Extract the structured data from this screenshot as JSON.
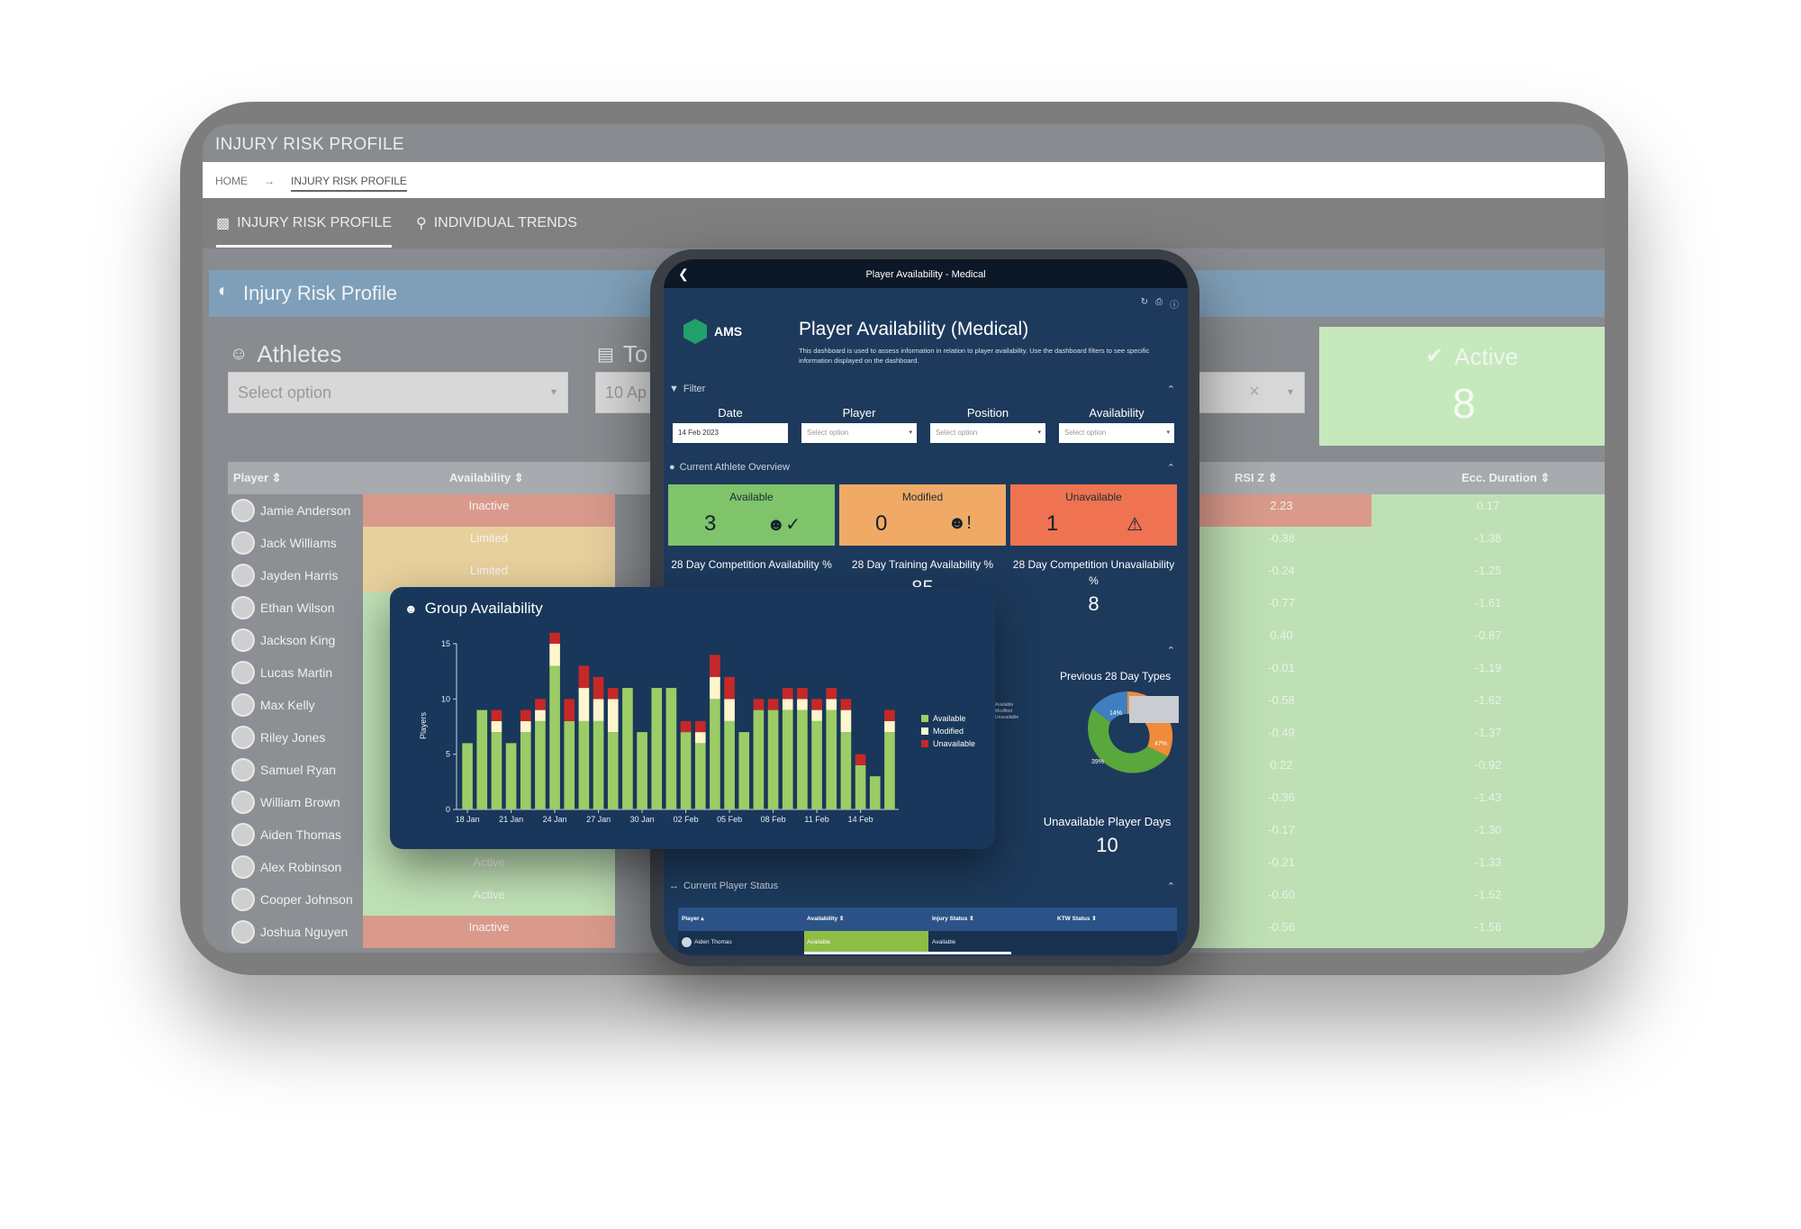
{
  "background_app": {
    "title": "INJURY RISK PROFILE",
    "breadcrumb": [
      "HOME",
      "→",
      "INJURY RISK PROFILE"
    ],
    "tabs": [
      "INJURY RISK PROFILE",
      "INDIVIDUAL TRENDS"
    ],
    "section_title": "Injury Risk Profile",
    "filters": {
      "athletes_label": "Athletes",
      "athletes_placeholder": "Select option",
      "to_label": "To",
      "to_value": "10 Ap"
    },
    "active_card": {
      "label": "Active",
      "value": "8"
    },
    "columns": {
      "player": "Player ⇕",
      "availability": "Availability ⇕",
      "rsi": "RSI Z ⇕",
      "ecc": "Ecc. Duration ⇕"
    },
    "rows": [
      {
        "player": "Jamie Anderson",
        "availability": "Inactive",
        "rsi": "2.23",
        "ecc": "0.17"
      },
      {
        "player": "Jack Williams",
        "availability": "Limited",
        "rsi": "-0.38",
        "ecc": "-1.38"
      },
      {
        "player": "Jayden Harris",
        "availability": "Limited",
        "rsi": "-0.24",
        "ecc": "-1.25"
      },
      {
        "player": "Ethan Wilson",
        "availability": "",
        "rsi": "-0.77",
        "ecc": "-1.61"
      },
      {
        "player": "Jackson King",
        "availability": "",
        "rsi": "0.40",
        "ecc": "-0.87"
      },
      {
        "player": "Lucas Martin",
        "availability": "",
        "rsi": "-0.01",
        "ecc": "-1.19"
      },
      {
        "player": "Max Kelly",
        "availability": "",
        "rsi": "-0.58",
        "ecc": "-1.62"
      },
      {
        "player": "Riley Jones",
        "availability": "",
        "rsi": "-0.49",
        "ecc": "-1.37"
      },
      {
        "player": "Samuel Ryan",
        "availability": "",
        "rsi": "0.22",
        "ecc": "-0.92"
      },
      {
        "player": "William Brown",
        "availability": "",
        "rsi": "-0.36",
        "ecc": "-1.43"
      },
      {
        "player": "Aiden Thomas",
        "availability": "",
        "rsi": "-0.17",
        "ecc": "-1.30"
      },
      {
        "player": "Alex Robinson",
        "availability": "Active",
        "rsi": "-0.21",
        "ecc": "-1.33"
      },
      {
        "player": "Cooper Johnson",
        "availability": "Active",
        "rsi": "-0.60",
        "ecc": "-1.52"
      },
      {
        "player": "Joshua Nguyen",
        "availability": "Inactive",
        "rsi": "-0.56",
        "ecc": "-1.56"
      }
    ]
  },
  "mobile_app": {
    "window_title": "Player Availability - Medical",
    "logo": "AMS",
    "heading": "Player Availability (Medical)",
    "description": "This dashboard is used to assess information in relation to player availability. Use the dashboard filters to see specific information displayed on the dashboard.",
    "filter_section": "Filter",
    "filters": {
      "date_label": "Date",
      "date_value": "14 Feb 2023",
      "player_label": "Player",
      "player_placeholder": "Select option",
      "position_label": "Position",
      "position_placeholder": "Select option",
      "availability_label": "Availability",
      "availability_placeholder": "Select option"
    },
    "overview_section": "Current Athlete Overview",
    "cards": [
      {
        "label": "Available",
        "value": "3",
        "color": "#7fc46a"
      },
      {
        "label": "Modified",
        "value": "0",
        "color": "#f0aa66"
      },
      {
        "label": "Unavailable",
        "value": "1",
        "color": "#ef7350"
      }
    ],
    "stats": {
      "comp_avail_label": "28 Day Competition Availability %",
      "train_avail_label": "28 Day Training Availability %",
      "train_avail_value": "85",
      "comp_unavail_label": "28 Day Competition Unavailability %",
      "comp_unavail_value": "8"
    },
    "donut": {
      "title": "Previous 28 Day Types",
      "labels": [
        "14%",
        "47%",
        "39%"
      ],
      "mini_legend": [
        "Available",
        "Modified",
        "Unavailable"
      ]
    },
    "unavailable_days": {
      "label": "Unavailable Player Days",
      "value": "10"
    },
    "status_section": "Current Player Status",
    "status_columns": [
      "Player ▴",
      "Availability ⇕",
      "Injury Status ⇕",
      "KTW Status ⇕"
    ],
    "status_rows": [
      {
        "player": "Aiden Thomas",
        "availability": "Available",
        "injury": "Available",
        "ktw": ""
      }
    ]
  },
  "group_availability": {
    "title": "Group Availability",
    "chart_data": {
      "type": "bar",
      "stacked": true,
      "ylabel": "Players",
      "ylim": [
        0,
        15
      ],
      "yticks": [
        0,
        5,
        10,
        15
      ],
      "x_tick_labels": [
        "18 Jan",
        "21 Jan",
        "24 Jan",
        "27 Jan",
        "30 Jan",
        "02 Feb",
        "05 Feb",
        "08 Feb",
        "11 Feb",
        "14 Feb"
      ],
      "legend_position": "right",
      "series": [
        {
          "name": "Available",
          "color": "#9ccc65",
          "values": [
            6,
            9,
            7,
            6,
            7,
            8,
            13,
            8,
            8,
            8,
            7,
            11,
            7,
            11,
            11,
            7,
            6,
            10,
            8,
            7,
            9,
            9,
            9,
            9,
            8,
            9,
            7,
            4,
            3,
            7
          ]
        },
        {
          "name": "Modified",
          "color": "#fff5cc",
          "values": [
            0,
            0,
            1,
            0,
            1,
            1,
            2,
            0,
            3,
            2,
            3,
            0,
            0,
            0,
            0,
            0,
            1,
            2,
            2,
            0,
            0,
            0,
            1,
            1,
            1,
            1,
            2,
            0,
            0,
            1
          ]
        },
        {
          "name": "Unavailable",
          "color": "#c62828",
          "values": [
            0,
            0,
            1,
            0,
            1,
            1,
            1,
            2,
            2,
            2,
            1,
            0,
            0,
            0,
            0,
            1,
            1,
            2,
            2,
            0,
            1,
            1,
            1,
            1,
            1,
            1,
            1,
            1,
            0,
            1
          ]
        }
      ]
    }
  }
}
